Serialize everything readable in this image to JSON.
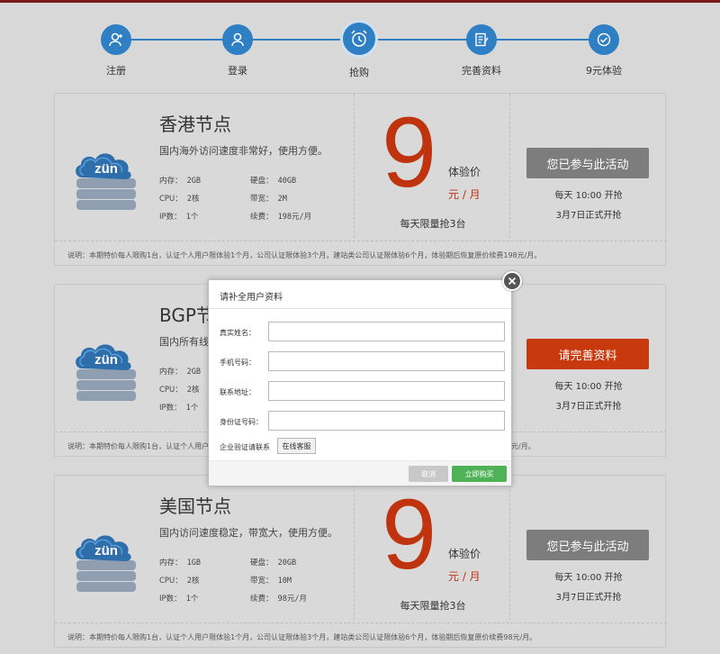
{
  "colors": {
    "step_blue": "#2f7fc4",
    "price_red": "#c0330f",
    "btn_gray": "#7d7d7d",
    "btn_red": "#c83a0e",
    "btn_green": "#4fb257"
  },
  "steps": [
    {
      "label": "注册",
      "icon": "user-add-icon"
    },
    {
      "label": "登录",
      "icon": "user-icon"
    },
    {
      "label": "抢购",
      "icon": "alarm-clock-icon"
    },
    {
      "label": "完善资料",
      "icon": "edit-document-icon"
    },
    {
      "label": "9元体验",
      "icon": "check-circle-icon"
    }
  ],
  "logo_text": "zün",
  "cards": [
    {
      "title": "香港节点",
      "desc": "国内海外访问速度非常好，使用方便。",
      "specs": {
        "mem_k": "内存：",
        "mem_v": "2GB",
        "disk_k": "硬盘：",
        "disk_v": "40GB",
        "cpu_k": "CPU：",
        "cpu_v": "2核",
        "bw_k": "带宽：",
        "bw_v": "2M",
        "ip_k": "IP数：",
        "ip_v": "1个",
        "renew_k": "续费：",
        "renew_v": "198元/月"
      },
      "price": "9",
      "price_label": "体验价",
      "price_unit": "元 / 月",
      "limit": "每天限量抢3台",
      "action": "您已参与此活动",
      "daily": "每天 10:00 开抢",
      "start": "3月7日正式开抢",
      "note": "说明：本期特价每人限购1台，认证个人用户限体验1个月，公司认证限体验3个月，建站类公司认证限体验6个月，体验期后恢复原价续费198元/月。"
    },
    {
      "title": "BGP节",
      "desc": "国内所有线",
      "specs": {
        "mem_k": "内存：",
        "mem_v": "2GB",
        "cpu_k": "CPU：",
        "cpu_v": "2核",
        "ip_k": "IP数：",
        "ip_v": "1个"
      },
      "action": "请完善资料",
      "daily": "每天 10:00 开抢",
      "start": "3月7日正式开抢",
      "note": "说明：本期特价每人限购1台，认证个人用户限",
      "note_tail": "元/月。"
    },
    {
      "title": "美国节点",
      "desc": "国内访问速度稳定，带宽大，使用方便。",
      "specs": {
        "mem_k": "内存：",
        "mem_v": "1GB",
        "disk_k": "硬盘：",
        "disk_v": "20GB",
        "cpu_k": "CPU：",
        "cpu_v": "2核",
        "bw_k": "带宽：",
        "bw_v": "10M",
        "ip_k": "IP数：",
        "ip_v": "1个",
        "renew_k": "续费：",
        "renew_v": "98元/月"
      },
      "price": "9",
      "price_label": "体验价",
      "price_unit": "元 / 月",
      "limit": "每天限量抢3台",
      "action": "您已参与此活动",
      "daily": "每天 10:00 开抢",
      "start": "3月7日正式开抢",
      "note": "说明：本期特价每人限购1台，认证个人用户限体验1个月，公司认证限体验3个月，建站类公司认证限体验6个月，体验期后恢复原价续费98元/月。"
    }
  ],
  "modal": {
    "title": "请补全用户资料",
    "fields": [
      {
        "label": "真实姓名：",
        "value": "",
        "placeholder": ""
      },
      {
        "label": "手机号码：",
        "value": "",
        "placeholder": ""
      },
      {
        "label": "联系地址：",
        "value": "",
        "placeholder": ""
      },
      {
        "label": "身份证号码：",
        "value": "",
        "placeholder": ""
      }
    ],
    "enterprise_label": "企业验证请联系",
    "online_service": "在线客服",
    "cancel": "取消",
    "buy": "立即购买"
  }
}
